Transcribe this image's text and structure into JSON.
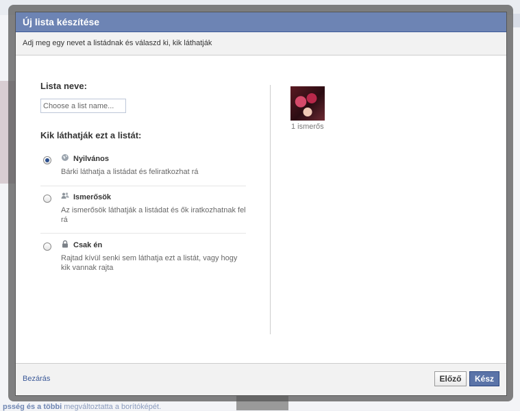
{
  "background": {
    "activity_text_bold": "psség és a többi",
    "activity_text": " megváltoztatta a borítóképét."
  },
  "dialog": {
    "title": "Új lista készítése",
    "subtitle": "Adj meg egy nevet a listádnak és válaszd ki, kik láthatják",
    "name_label": "Lista neve:",
    "name_placeholder": "Choose a list name...",
    "name_value": "",
    "visibility_label": "Kik láthatják ezt a listát:",
    "options": [
      {
        "icon": "globe-icon",
        "title": "Nyilvános",
        "desc": "Bárki láthatja a listádat és feliratkozhat rá",
        "selected": true
      },
      {
        "icon": "friends-icon",
        "title": "Ismerősök",
        "desc": "Az ismerősök láthatják a listádat és ők iratkozhatnak fel rá",
        "selected": false
      },
      {
        "icon": "lock-icon",
        "title": "Csak én",
        "desc": "Rajtad kívül senki sem láthatja ezt a listát, vagy hogy kik vannak rajta",
        "selected": false
      }
    ],
    "friend_count": "1 ismerős",
    "footer": {
      "close": "Bezárás",
      "prev": "Előző",
      "done": "Kész"
    }
  },
  "colors": {
    "header_bg": "#6d84b4",
    "primary_button": "#5b74a8",
    "link": "#3b5998"
  }
}
